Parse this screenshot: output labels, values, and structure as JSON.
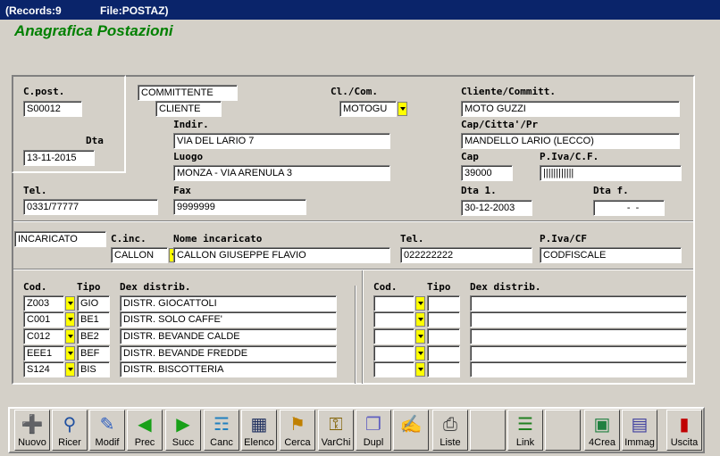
{
  "window": {
    "records": "(Records:9",
    "file": "File:POSTAZ)"
  },
  "app_title": "Anagrafica Postazioni",
  "labels": {
    "cpost": "C.post.",
    "dta": "Dta",
    "clcom": "Cl./Com.",
    "cliente_committ": "Cliente/Committ.",
    "indir": "Indir.",
    "cap_citta": "Cap/Citta'/Pr",
    "luogo": "Luogo",
    "cap": "Cap",
    "piva_cf": "P.Iva/C.F.",
    "tel": "Tel.",
    "fax": "Fax",
    "dta1": "Dta 1.",
    "dtaf": "Dta f.",
    "cinc": "C.inc.",
    "nome_incaricato": "Nome incaricato",
    "tel2": "Tel.",
    "piva_cf2": "P.Iva/CF",
    "cod": "Cod.",
    "tipo": "Tipo",
    "dex": "Dex distrib."
  },
  "fields": {
    "cpost": "S00012",
    "dta": "13-11-2015",
    "committente": "COMMITTENTE",
    "cliente": "CLIENTE",
    "clcom": "MOTOGU",
    "cliente_committ": "MOTO GUZZI",
    "indir": "VIA DEL LARIO 7",
    "cap_citta": "MANDELLO LARIO (LECCO)",
    "luogo": "MONZA - VIA ARENULA 3",
    "cap": "39000",
    "piva": "||||||||||||",
    "tel": "0331/77777",
    "fax": "9999999",
    "dta1": "30-12-2003",
    "dtaf": "  -  -",
    "incaricato": "INCARICATO",
    "cinc": "CALLON",
    "nome_incaricato": "CALLON GIUSEPPE FLAVIO",
    "tel2": "022222222",
    "piva2": "CODFISCALE"
  },
  "distrib_left": [
    {
      "cod": "Z003",
      "tipo": "GIO",
      "dex": "DISTR. GIOCATTOLI"
    },
    {
      "cod": "C001",
      "tipo": "BE1",
      "dex": "DISTR. SOLO CAFFE'"
    },
    {
      "cod": "C012",
      "tipo": "BE2",
      "dex": "DISTR. BEVANDE CALDE"
    },
    {
      "cod": "EEE1",
      "tipo": "BEF",
      "dex": "DISTR. BEVANDE FREDDE"
    },
    {
      "cod": "S124",
      "tipo": "BIS",
      "dex": "DISTR. BISCOTTERIA"
    }
  ],
  "toolbar": [
    {
      "icon": "new-icon",
      "label": "Nuovo"
    },
    {
      "icon": "search-icon",
      "label": "Ricer"
    },
    {
      "icon": "edit-icon",
      "label": "Modif"
    },
    {
      "icon": "prev-icon",
      "label": "Prec"
    },
    {
      "icon": "next-icon",
      "label": "Succ"
    },
    {
      "icon": "trash-icon",
      "label": "Canc"
    },
    {
      "icon": "list-icon",
      "label": "Elenco"
    },
    {
      "icon": "find-icon",
      "label": "Cerca"
    },
    {
      "icon": "keys-icon",
      "label": "VarChi"
    },
    {
      "icon": "duplicate-icon",
      "label": "Dupl"
    },
    {
      "icon": "pen-icon",
      "label": ""
    },
    {
      "icon": "print-icon",
      "label": "Liste"
    },
    {
      "icon": "blank-icon",
      "label": ""
    },
    {
      "icon": "link-icon",
      "label": "Link"
    },
    {
      "icon": "blank-icon",
      "label": ""
    },
    {
      "icon": "create-icon",
      "label": "4Crea"
    },
    {
      "icon": "image-icon",
      "label": "Immag"
    },
    {
      "icon": "exit-icon",
      "label": "Uscita"
    }
  ]
}
